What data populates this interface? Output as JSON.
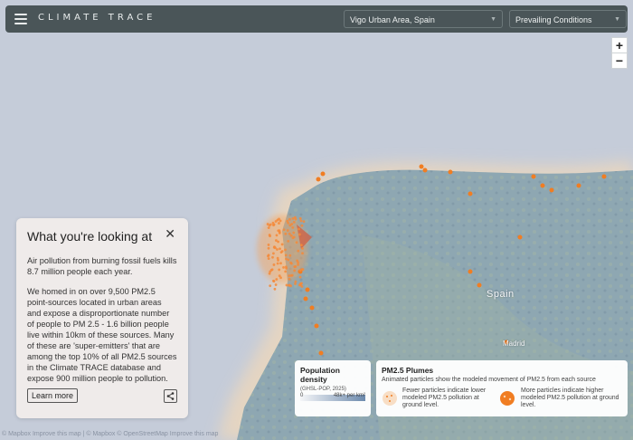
{
  "header": {
    "logo_text": "CLIMATE TRACE",
    "location_select": "Vigo Urban Area, Spain",
    "conditions_select": "Prevailing Conditions"
  },
  "zoom": {
    "in_label": "+",
    "out_label": "−"
  },
  "map_labels": {
    "country": "Spain",
    "city": "Madrid"
  },
  "info_panel": {
    "title": "What you're looking at",
    "paragraph1": "Air pollution from burning fossil fuels kills 8.7 million people each year.",
    "paragraph2": "We homed in on over 9,500 PM2.5 point-sources located in urban areas and expose a disproportionate number of people to PM 2.5 - 1.6 billion people live within 10km of these sources. Many of these are 'super-emitters' that are among the top 10% of all PM2.5 sources in the Climate TRACE database and expose 900 million people to pollution.",
    "learn_more_label": "Learn more"
  },
  "population_legend": {
    "title": "Population density",
    "subtitle": "(GHSL-POP, 2025)",
    "min_label": "0",
    "max_label": "48k+ per km²"
  },
  "plumes_legend": {
    "title": "PM2.5 Plumes",
    "subtitle": "Animated particles show the modeled movement of PM2.5 from each source",
    "fewer_label": "Fewer particles indicate lower modeled PM2.5 pollution at ground level.",
    "more_label": "More particles indicate higher modeled PM2.5 pollution at ground level."
  },
  "attribution": "© Mapbox Improve this map | © Mapbox © OpenStreetMap Improve this map",
  "colors": {
    "header_bg": "#4a5558",
    "accent_orange": "#f07d22",
    "ocean": "#c5ccd9",
    "land": "#8aa3b0"
  }
}
